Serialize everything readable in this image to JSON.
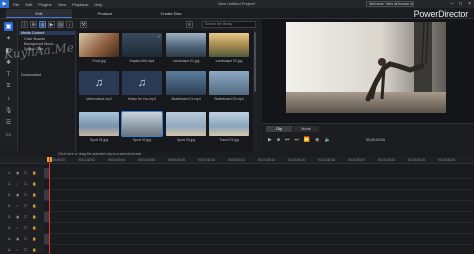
{
  "menubar": {
    "items": [
      "File",
      "Edit",
      "Plugins",
      "View",
      "Playback",
      "Help"
    ],
    "project_title": "New Untitled Project*",
    "notice": "Welcome: View all tutorial videos here!"
  },
  "modes": [
    "Edit",
    "Produce",
    "Create Disc"
  ],
  "brand": "PowerDirector",
  "search": {
    "placeholder": "Search the library"
  },
  "tree": {
    "items": [
      "Media Content",
      "Color Boards",
      "Background Music",
      "Sound Clips",
      "Downloaded"
    ]
  },
  "library": [
    {
      "caption": "Food.jpg",
      "kind": "photo",
      "color": "#6a4a35"
    },
    {
      "caption": "Kayaks.Mvi.mp4",
      "kind": "photo",
      "color": "#2c3b4b",
      "checked": true
    },
    {
      "caption": "Landscape 01.jpg",
      "kind": "photo",
      "color": "#6b7f93"
    },
    {
      "caption": "Landscape 02.jpg",
      "kind": "photo",
      "color": "#a68a55"
    },
    {
      "caption": "Mahoroland.mp3",
      "kind": "music"
    },
    {
      "caption": "Music for You.mp3",
      "kind": "music"
    },
    {
      "caption": "Skateboard 01.mp4",
      "kind": "photo",
      "color": "#35495e"
    },
    {
      "caption": "Skateboard 02.mp4",
      "kind": "photo",
      "color": "#5a6e82"
    },
    {
      "caption": "Sport 01.jpg",
      "kind": "photo",
      "color": "#7d99b5"
    },
    {
      "caption": "Sport 02.jpg",
      "kind": "photo",
      "color": "#8aa2b4"
    },
    {
      "caption": "Sport 03.jpg",
      "kind": "photo",
      "color": "#a7b9c8"
    },
    {
      "caption": "Travel 01.jpg",
      "kind": "photo",
      "color": "#9bb3c6"
    }
  ],
  "player": {
    "tabs": [
      "Clip",
      "Movie"
    ],
    "timecode": "00;00;00;00",
    "zoom": "Fit"
  },
  "hint": "Click here or drag the selected clip to a selected track.",
  "ruler": [
    "00;00;00;00",
    "00;01;30;02",
    "00;03;00;04",
    "00;04;30;06",
    "00;06;00;08",
    "00;07;30;10",
    "00;09;00;12",
    "00;10;30;14",
    "00;12;00;16",
    "00;13;30;18",
    "00;15;00;20",
    "00;16;30;22",
    "00;18;00;24",
    "00;19;30;26"
  ],
  "tracks": [
    "1.",
    "1.",
    "2.",
    "2.",
    "3.",
    "3.",
    "4.",
    "4."
  ],
  "watermark": "KuyhAa.Me",
  "colors": {
    "accent": "#3b7ee0",
    "playhead": "#d7372e"
  }
}
